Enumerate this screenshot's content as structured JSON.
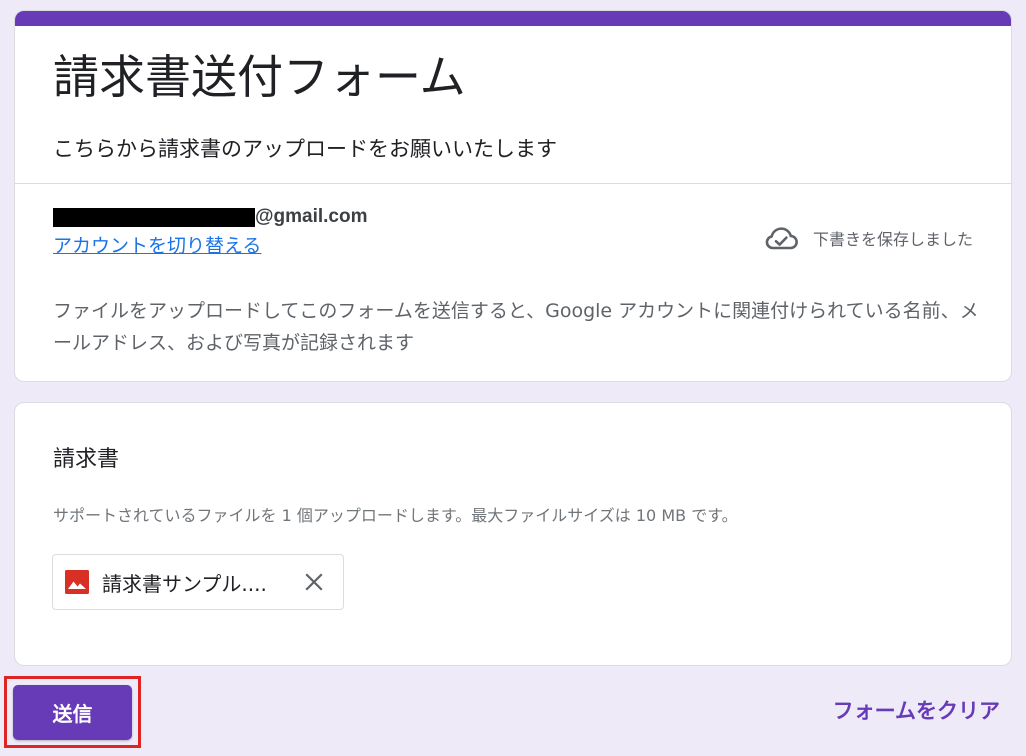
{
  "form": {
    "title": "請求書送付フォーム",
    "description": "こちらから請求書のアップロードをお願いいたします",
    "accent_color": "#673ab7",
    "background_color": "#efeaf8"
  },
  "account": {
    "email_domain": "@gmail.com",
    "switch_label": "アカウントを切り替える",
    "draft_status": "下書きを保存しました",
    "draft_icon": "cloud-done-icon",
    "notice": "ファイルをアップロードしてこのフォームを送信すると、Google アカウントに関連付けられている名前、メールアドレス、および写真が記録されます"
  },
  "question": {
    "title": "請求書",
    "help_text": "サポートされているファイルを 1 個アップロードします。最大ファイルサイズは 10 MB です。",
    "file": {
      "name": "請求書サンプル....",
      "icon": "image-file-icon",
      "icon_color": "#d93025",
      "remove_icon": "close-icon"
    }
  },
  "actions": {
    "submit_label": "送信",
    "clear_label": "フォームをクリア",
    "highlight_color": "#e02424"
  }
}
